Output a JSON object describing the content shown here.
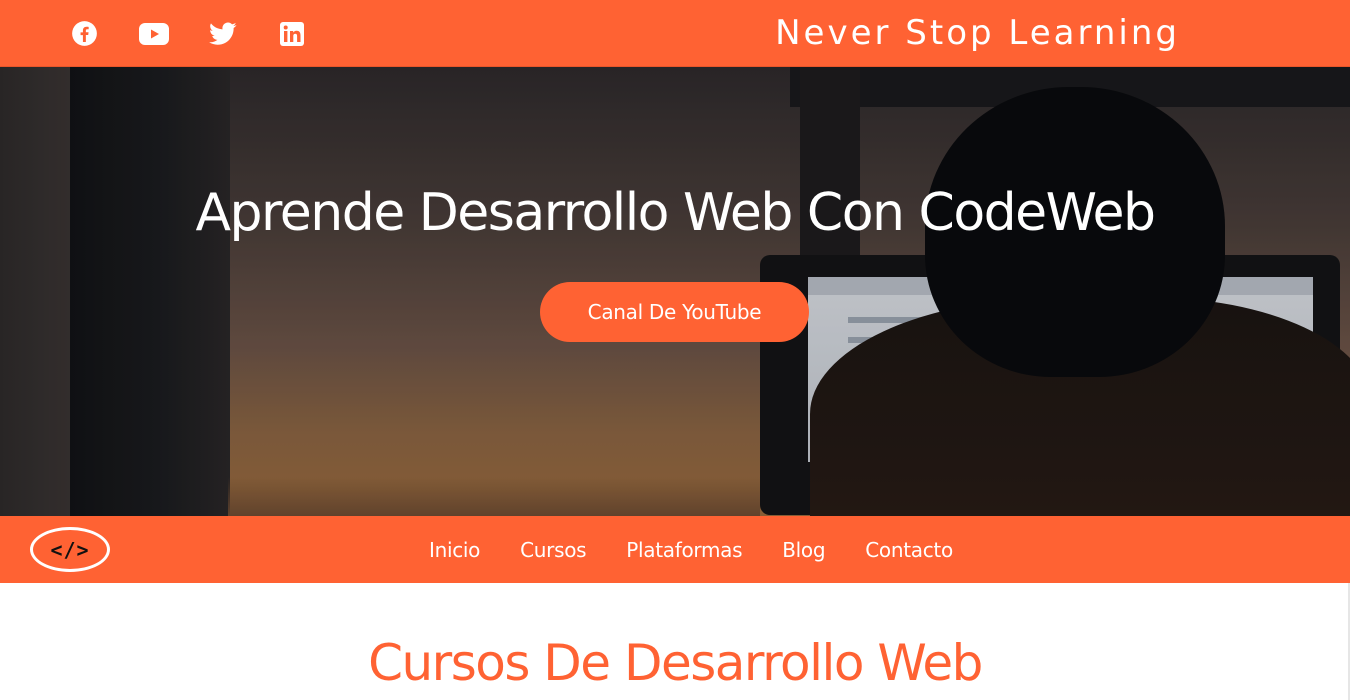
{
  "topbar": {
    "social": [
      {
        "icon": "facebook-icon"
      },
      {
        "icon": "youtube-icon"
      },
      {
        "icon": "twitter-icon"
      },
      {
        "icon": "linkedin-icon"
      }
    ],
    "tagline": "Never Stop Learning"
  },
  "hero": {
    "title": "Aprende Desarrollo Web Con CodeWeb",
    "cta_label": "Canal De YouTube"
  },
  "nav": {
    "logo_text": "</>",
    "items": [
      "Inicio",
      "Cursos",
      "Plataformas",
      "Blog",
      "Contacto"
    ]
  },
  "main": {
    "section_title": "Cursos De Desarrollo Web"
  },
  "colors": {
    "accent": "#ff6233",
    "text_on_accent": "#ffffff"
  }
}
